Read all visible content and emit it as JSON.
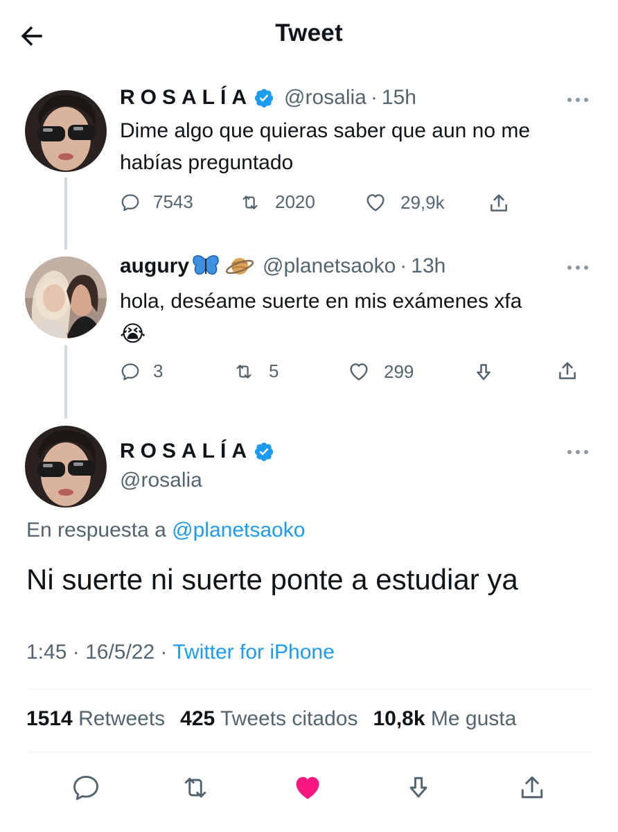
{
  "header": {
    "title": "Tweet",
    "back_icon": "arrow-left-icon"
  },
  "colors": {
    "accent": "#1d9bf0",
    "muted": "#536471",
    "like": "#f91880",
    "thread_line": "#cfd9de",
    "text": "#0f1419"
  },
  "thread": [
    {
      "display_name": "ROSALÍA",
      "verified": true,
      "handle": "@rosalia",
      "separator": "·",
      "time": "15h",
      "text_lines": [
        "Dime algo que quieras saber que aun no me",
        "habías preguntado"
      ],
      "actions": {
        "replies": "7543",
        "retweets": "2020",
        "likes": "29,9k"
      }
    },
    {
      "display_name": "augury",
      "emojis": [
        "butterfly",
        "ringed-planet"
      ],
      "handle": "@planetsaoko",
      "separator": "·",
      "time": "13h",
      "text_lines": [
        "hola, deséame suerte en mis exámenes xfa",
        "😭"
      ],
      "actions": {
        "replies": "3",
        "retweets": "5",
        "likes": "299"
      }
    }
  ],
  "main_tweet": {
    "display_name": "ROSALÍA",
    "verified": true,
    "handle": "@rosalia",
    "reply_prefix": "En respuesta a",
    "reply_to": "@planetsaoko",
    "text": "Ni suerte ni suerte ponte a estudiar ya",
    "time": "1:45",
    "separator": "·",
    "date": "16/5/22",
    "source": "Twitter for iPhone",
    "stats": [
      {
        "value": "1514",
        "label": "Retweets"
      },
      {
        "value": "425",
        "label": "Tweets citados"
      },
      {
        "value": "10,8k",
        "label": "Me gusta"
      }
    ],
    "liked": true
  }
}
